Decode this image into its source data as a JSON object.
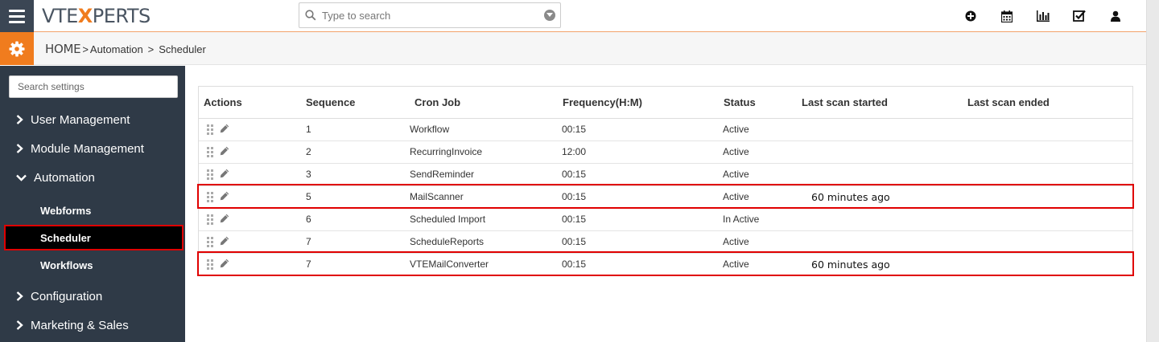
{
  "app": {
    "logo_left": "VTE",
    "logo_x": "X",
    "logo_right": "PERTS"
  },
  "search": {
    "placeholder": "Type to search"
  },
  "top_icons": [
    "plus-circle-icon",
    "calendar-icon",
    "bar-chart-icon",
    "checkbox-icon",
    "user-icon"
  ],
  "breadcrumb": {
    "home": "HOME",
    "sep": ">",
    "items": [
      "Automation",
      "Scheduler"
    ]
  },
  "sidebar": {
    "search_placeholder": "Search settings",
    "items": [
      {
        "label": "User Management",
        "expanded": false
      },
      {
        "label": "Module Management",
        "expanded": false
      },
      {
        "label": "Automation",
        "expanded": true
      },
      {
        "label": "Configuration",
        "expanded": false
      },
      {
        "label": "Marketing & Sales",
        "expanded": false
      }
    ],
    "subitems": [
      {
        "label": "Webforms",
        "active": false
      },
      {
        "label": "Scheduler",
        "active": true
      },
      {
        "label": "Workflows",
        "active": false
      }
    ]
  },
  "table": {
    "columns": [
      "Actions",
      "Sequence",
      "Cron Job",
      "Frequency(H:M)",
      "Status",
      "Last scan started",
      "Last scan ended"
    ],
    "rows": [
      {
        "sequence": "1",
        "cron": "Workflow",
        "frequency": "00:15",
        "status": "Active",
        "last_started": "",
        "last_ended": "",
        "highlight": false
      },
      {
        "sequence": "2",
        "cron": "RecurringInvoice",
        "frequency": "12:00",
        "status": "Active",
        "last_started": "",
        "last_ended": "",
        "highlight": false
      },
      {
        "sequence": "3",
        "cron": "SendReminder",
        "frequency": "00:15",
        "status": "Active",
        "last_started": "",
        "last_ended": "",
        "highlight": false
      },
      {
        "sequence": "5",
        "cron": "MailScanner",
        "frequency": "00:15",
        "status": "Active",
        "last_started": "60 minutes ago",
        "last_ended": "",
        "highlight": true
      },
      {
        "sequence": "6",
        "cron": "Scheduled Import",
        "frequency": "00:15",
        "status": "In Active",
        "last_started": "",
        "last_ended": "",
        "highlight": false
      },
      {
        "sequence": "7",
        "cron": "ScheduleReports",
        "frequency": "00:15",
        "status": "Active",
        "last_started": "",
        "last_ended": "",
        "highlight": false
      },
      {
        "sequence": "7",
        "cron": "VTEMailConverter",
        "frequency": "00:15",
        "status": "Active",
        "last_started": "60 minutes ago",
        "last_ended": "",
        "highlight": true
      }
    ]
  },
  "colors": {
    "accent": "#f07c1e",
    "sidebar": "#2f3a47",
    "highlight": "#e00000"
  }
}
